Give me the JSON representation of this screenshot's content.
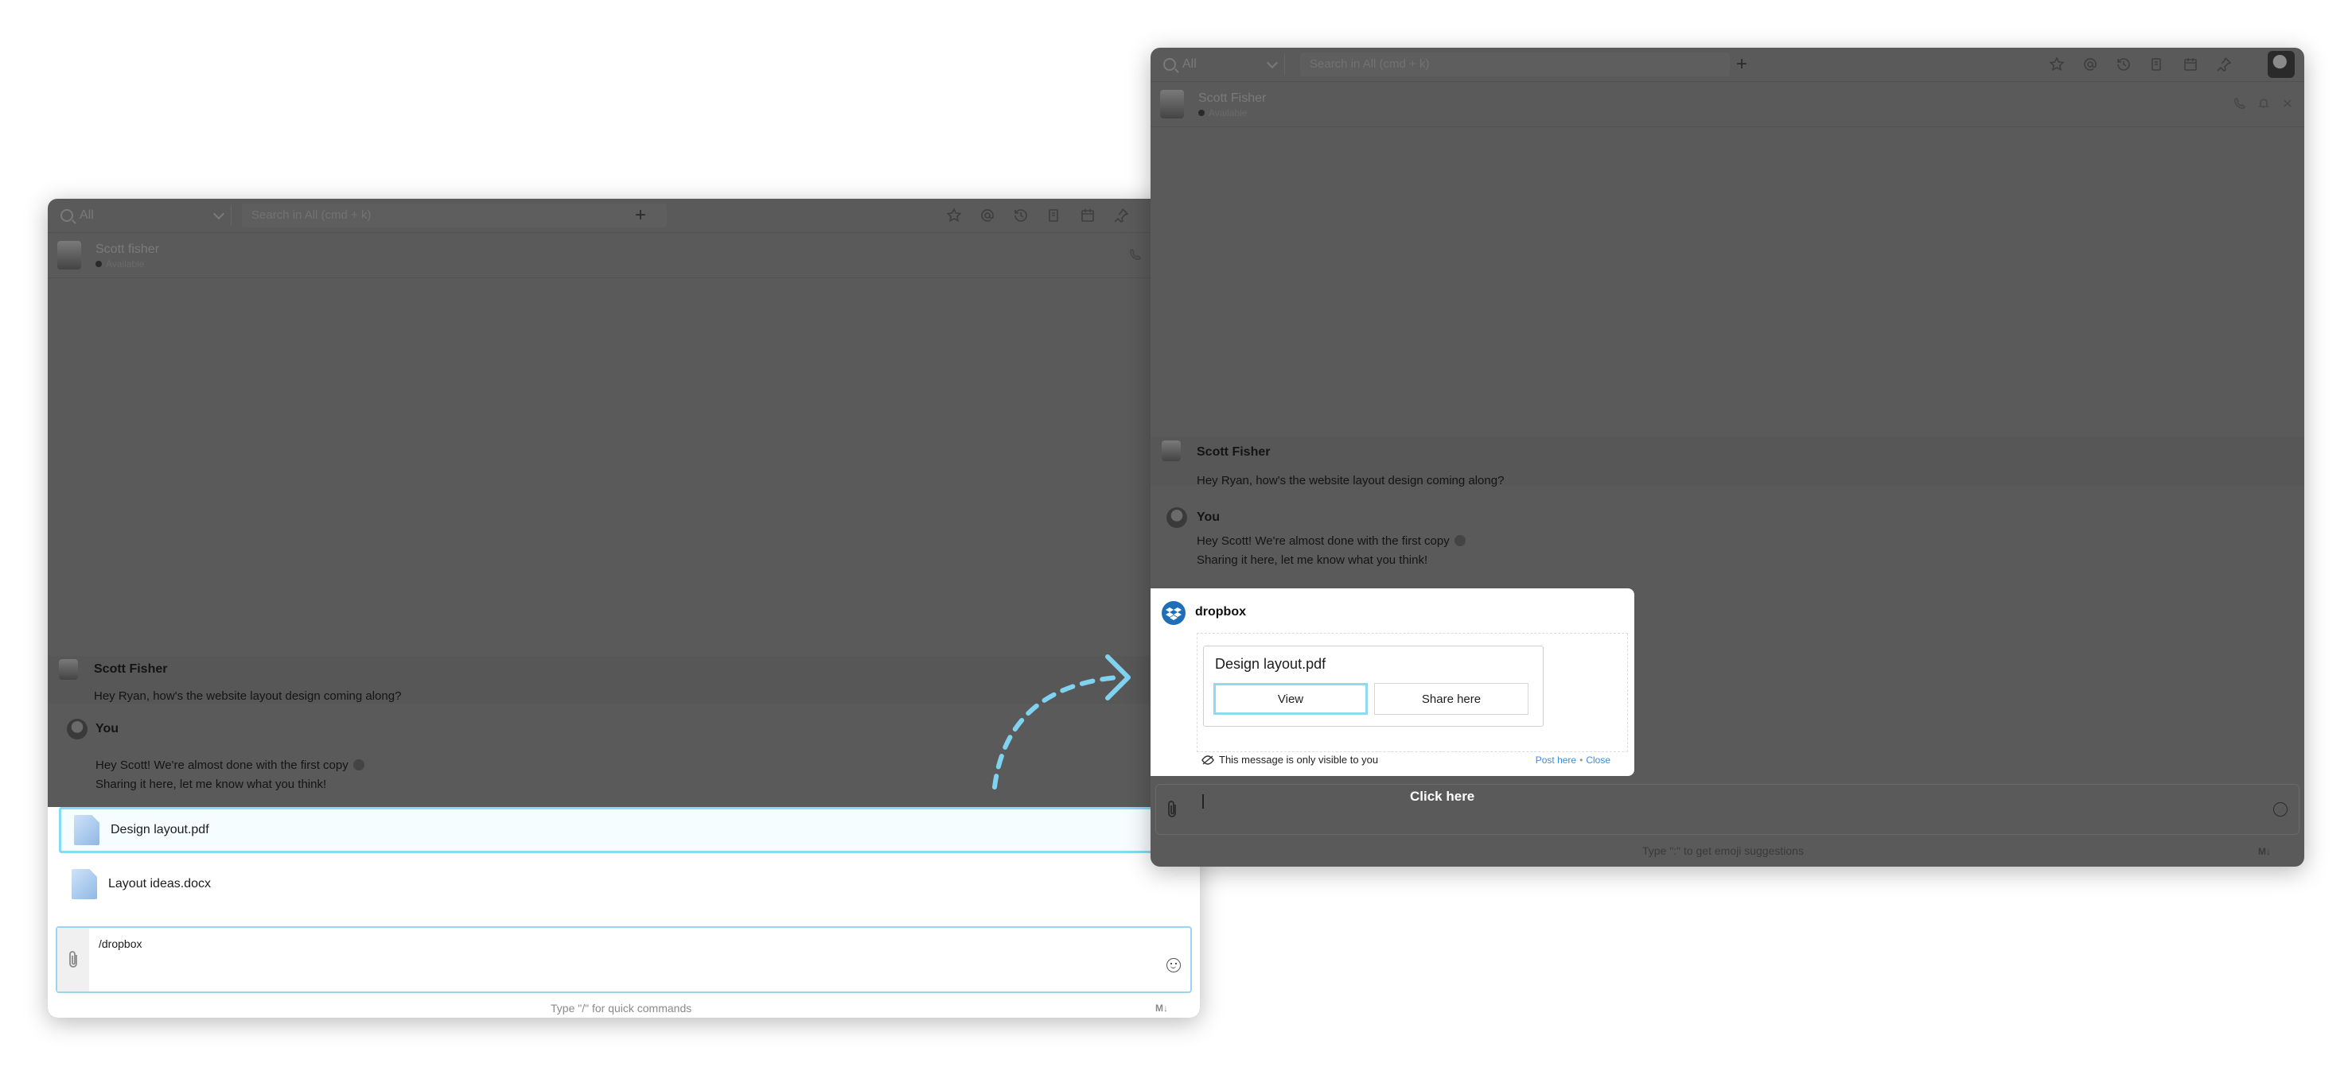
{
  "step1": {
    "topbar": {
      "scope": "All",
      "search_placeholder": "Search in All (cmd + k)"
    },
    "chat_header": {
      "name": "Scott fisher",
      "status": "Available"
    },
    "messages": [
      {
        "sender": "Scott Fisher",
        "lines": [
          "Hey Ryan, how's the website layout design coming along?"
        ]
      },
      {
        "sender": "You",
        "lines": [
          "Hey Scott! We're almost done with the first copy",
          "Sharing it here, let me know what you think!"
        ]
      }
    ],
    "file_suggestions": [
      {
        "name": "Design layout.pdf",
        "selected": true
      },
      {
        "name": "Layout ideas.docx",
        "selected": false
      }
    ],
    "composer": {
      "text": "/dropbox",
      "hint": "Type \"/\" for quick commands",
      "md_badge": "M↓"
    }
  },
  "step2": {
    "topbar": {
      "scope": "All",
      "search_placeholder": "Search in All (cmd + k)"
    },
    "chat_header": {
      "name": "Scott Fisher",
      "status": "Available"
    },
    "messages": [
      {
        "sender": "Scott Fisher",
        "lines": [
          "Hey Ryan, how's the website layout design coming along?"
        ]
      },
      {
        "sender": "You",
        "lines": [
          "Hey Scott! We're almost done with the first copy",
          "Sharing it here, let me know what you think!"
        ]
      }
    ],
    "dropbox_card": {
      "app_name": "dropbox",
      "file_name": "Design layout.pdf",
      "view_label": "View",
      "share_label": "Share here",
      "visibility_note": "This message is only visible to you",
      "post_here": "Post here",
      "close": "Close"
    },
    "callout": "Click here",
    "composer": {
      "hint": "Type \":\" to get emoji suggestions",
      "md_badge": "M↓"
    }
  },
  "colors": {
    "accent": "#88d9f3",
    "overlay": "#5a5a5a",
    "link": "#3d8cd6",
    "arrow": "#7fd2f0"
  }
}
